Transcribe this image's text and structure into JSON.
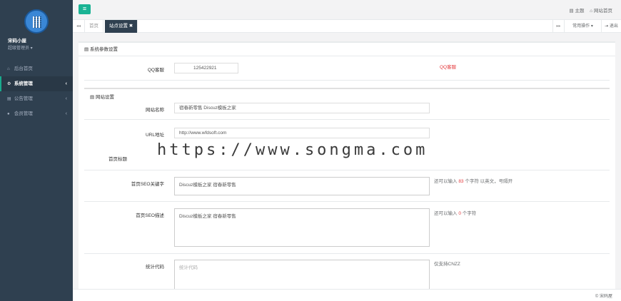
{
  "sidebar": {
    "profile_name": "宋码小屋",
    "profile_role": "超级管理员 ▾",
    "items": [
      {
        "icon": "home-icon",
        "glyph": "⌂",
        "label": "后台首页"
      },
      {
        "icon": "gear-icon",
        "glyph": "⚙",
        "label": "系统管理",
        "arrow": "‹"
      },
      {
        "icon": "doc-icon",
        "glyph": "▤",
        "label": "公告管理",
        "arrow": "‹"
      },
      {
        "icon": "user-icon",
        "glyph": "●",
        "label": "会员管理",
        "arrow": "‹"
      }
    ]
  },
  "topbar": {
    "menu_glyph": "≡",
    "theme_label": "▤ 主题",
    "home_label": "⌂ 网站首页"
  },
  "tabs": {
    "prev": "◂◂",
    "next": "▸▸",
    "items": [
      {
        "label": "首页"
      },
      {
        "label": "站点设置 ✖"
      }
    ],
    "ops_label": "常用操作 ▾",
    "logout_label": "⇥ 退出"
  },
  "panel": {
    "title": "▤ 系统参数设置",
    "qq": {
      "label": "QQ客服",
      "value": "125422921",
      "hint": "QQ客服"
    },
    "site_section": "▤ 网站设置",
    "site_name": {
      "label": "网站名称",
      "value": "宿春新零售 Discuz模板之家"
    },
    "url": {
      "label": "URL地址",
      "value": "http://www.wfdsoft.com"
    },
    "title_field": {
      "label": "首页标题"
    },
    "keywords": {
      "label": "首页SEO关键字",
      "value": "Discuz模板之家 宿春新零售",
      "hint_pre": "还可以输入 ",
      "hint_num": "83",
      "hint_post": " 个字符 以英文，号隔开"
    },
    "description": {
      "label": "首页SEO描述",
      "value": "Discuz模板之家 宿春新零售",
      "hint_pre": "还可以输入 ",
      "hint_num": "0",
      "hint_post": " 个字符"
    },
    "stats": {
      "label": "统计代码",
      "placeholder": "统计代码",
      "hint": "仅支持CNZZ"
    }
  },
  "watermark": "https://www.songma.com",
  "footer": "© 宋码屋"
}
